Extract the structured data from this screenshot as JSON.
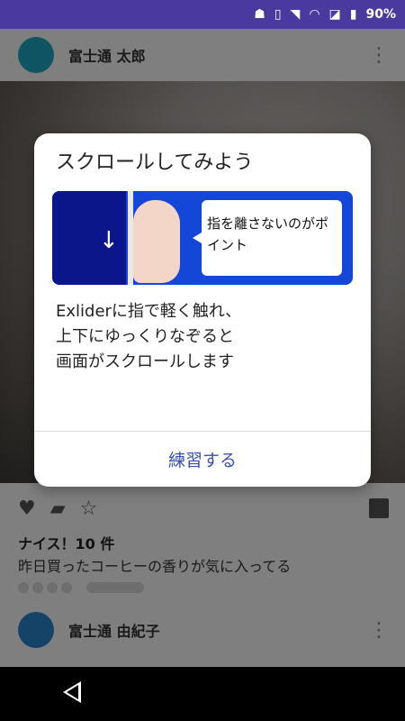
{
  "status_bar": {
    "battery_text": "90%",
    "icons": [
      "android-icon",
      "phone-icon",
      "wifi-calling-icon",
      "wifi-icon",
      "no-sim-icon",
      "battery-icon"
    ]
  },
  "feed": {
    "post1": {
      "username": "富士通 太郎",
      "likes": "ナイス！10 件",
      "caption": "昨日買ったコーヒーの香りが気に入ってる"
    },
    "post2": {
      "username": "富士通 由紀子"
    }
  },
  "dialog": {
    "title": "スクロールしてみよう",
    "bubble_text": "指を離さないのがポイント",
    "body_lines": [
      "Exliderに指で軽く触れ、",
      "上下にゆっくりなぞると",
      "画面がスクロールします"
    ],
    "practice_button": "練習する"
  },
  "colors": {
    "status_bar": "#4a3aa0",
    "illustration_blue": "#1446d8",
    "illustration_dark": "#0a168a",
    "accent_text": "#3b4fb0"
  }
}
